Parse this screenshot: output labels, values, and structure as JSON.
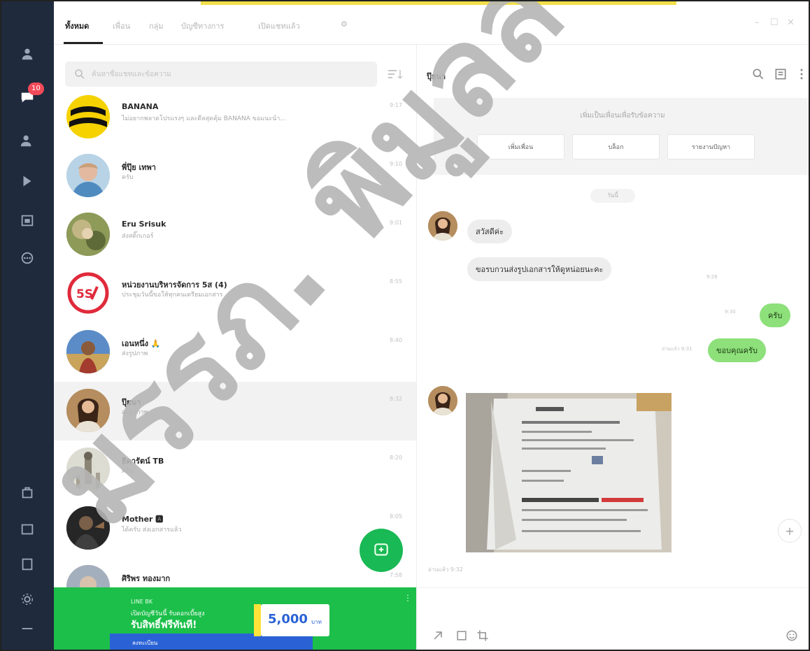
{
  "app": {
    "badge_count": "10"
  },
  "topbar": {
    "tabs": [
      "ทั้งหมด",
      "เพื่อน",
      "กลุ่ม",
      "บัญชีทางการ",
      "เปิดแชทแล้ว"
    ],
    "active_tab_index": 0
  },
  "list": {
    "search_placeholder": "ค้นหาชื่อแชทและข้อความ",
    "chats": [
      {
        "name": "BANANA",
        "message": "ไม่อยากพลาดโปรแรงๆ และดีลสุดคุ้ม BANANA ขอแนะนำ...",
        "time": "9:17",
        "selected": false
      },
      {
        "name": "พี่ปุ๊ย เทพา",
        "message": "ครับ",
        "time": "9:10",
        "selected": false
      },
      {
        "name": "Eru Srisuk",
        "message": "ส่งสติ๊กเกอร์",
        "time": "9:01",
        "selected": false
      },
      {
        "name": "หน่วยงานบริหารจัดการ 5ส (4)",
        "message": "ประชุมวันนี้ขอให้ทุกคนเตรียมเอกสาร",
        "time": "8:55",
        "selected": false
      },
      {
        "name": "เอนหนึ่ง 🙏",
        "message": "ส่งรูปภาพ",
        "time": "8:40",
        "selected": false
      },
      {
        "name": "ปุ๊ยนา",
        "message": "ส่งรูปภาพ",
        "time": "8:32",
        "selected": true
      },
      {
        "name": "ธิดารัตน์ TB",
        "message": "ครับ",
        "time": "8:20",
        "selected": false
      },
      {
        "name": "Mother 🅰",
        "message": "ได้ครับ ส่งเอกสารแล้ว",
        "time": "8:05",
        "selected": false
      },
      {
        "name": "ศิริพร ทองมาก",
        "message": "",
        "time": "7:58",
        "selected": false
      }
    ],
    "ad": {
      "small": "LINE BK",
      "line1": "เปิดบัญชีวันนี้ รับดอกเบี้ยสูง",
      "line2": "รับสิทธิ์ฟรีทันที!",
      "amount": "5,000",
      "unit": "บาท",
      "line3": "ลงทะเบียน"
    }
  },
  "chat": {
    "title": "ปุ๊ยนา",
    "title_sub": "(2)",
    "promo_title": "เพิ่มเป็นเพื่อนเพื่อรับข้อความ",
    "promo_buttons": [
      "เพิ่มเพื่อน",
      "บล็อก",
      "รายงานปัญหา"
    ],
    "date": "วันนี้",
    "messages": [
      {
        "dir": "in",
        "text": "สวัสดีค่ะ"
      },
      {
        "dir": "in",
        "text": "ขอรบกวนส่งรูปเอกสารให้ดูหน่อยนะคะ",
        "meta": "9:28"
      },
      {
        "dir": "out",
        "text": "ครับ",
        "meta": "9:30"
      },
      {
        "dir": "out",
        "text": "ขอบคุณครับ",
        "meta": "อ่านแล้ว 9:31"
      }
    ],
    "photo_caption": "อ่านแล้ว 9:32"
  },
  "watermark": "มรรภ. พิมูลส์"
}
